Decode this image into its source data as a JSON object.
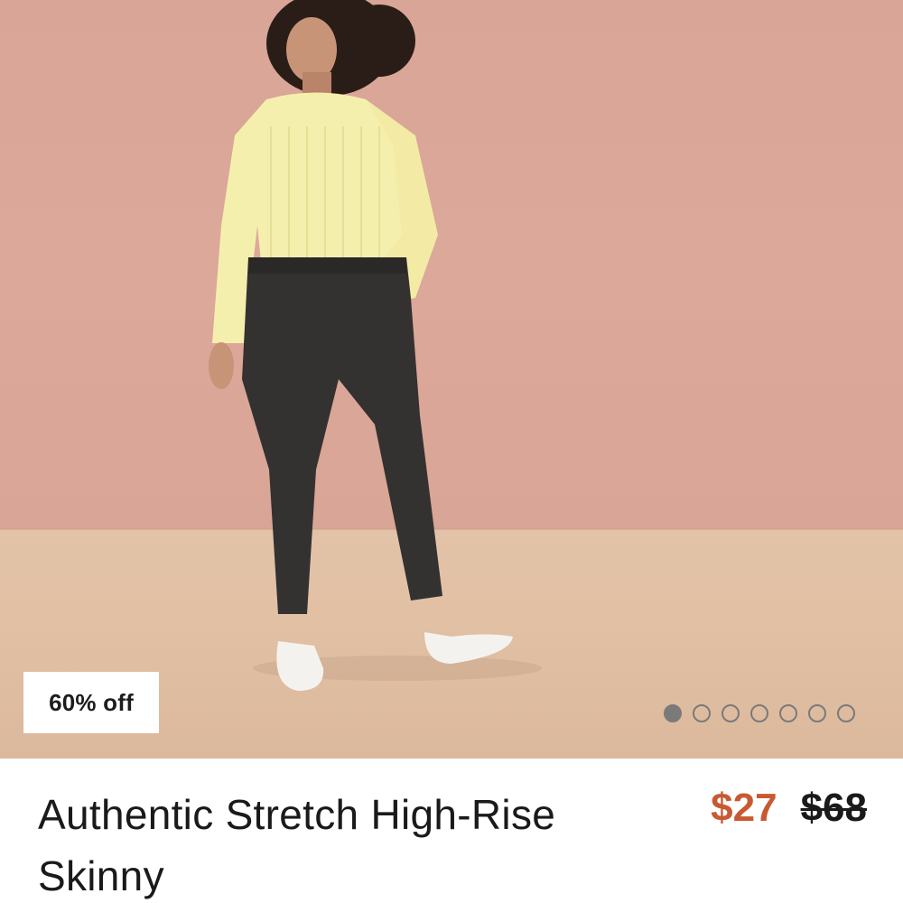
{
  "product": {
    "discount_badge": "60% off",
    "title": "Authentic Stretch High-Rise Skinny",
    "sale_price": "$27",
    "original_price": "$68"
  },
  "carousel": {
    "total_images": 7,
    "active_index": 0
  },
  "colors": {
    "sale_price": "#c75a32",
    "wall": "#dca89a",
    "floor": "#e1c0a4",
    "dot": "#7a7a7a"
  },
  "image": {
    "icon": "product-photo-icon"
  }
}
